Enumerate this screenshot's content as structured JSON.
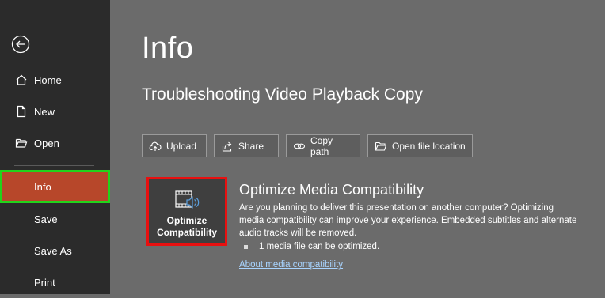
{
  "sidebar": {
    "back_icon": "back-arrow-icon",
    "items": [
      {
        "label": "Home",
        "icon": "home-icon"
      },
      {
        "label": "New",
        "icon": "new-document-icon"
      },
      {
        "label": "Open",
        "icon": "open-folder-icon"
      },
      {
        "label": "Info",
        "active": true
      },
      {
        "label": "Save"
      },
      {
        "label": "Save As"
      },
      {
        "label": "Print"
      }
    ]
  },
  "main": {
    "title": "Info",
    "document_title": "Troubleshooting Video Playback Copy",
    "actions": [
      {
        "label": "Upload",
        "icon": "upload-cloud-icon"
      },
      {
        "label": "Share",
        "icon": "share-icon"
      },
      {
        "label": "Copy path",
        "icon": "link-icon"
      },
      {
        "label": "Open file location",
        "icon": "folder-icon"
      }
    ],
    "optimize": {
      "button_line1": "Optimize",
      "button_line2": "Compatibility",
      "icon": "media-audio-icon",
      "heading": "Optimize Media Compatibility",
      "description": "Are you planning to deliver this presentation on another computer? Optimizing media compatibility can improve your experience. Embedded subtitles and alternate audio tracks will be removed.",
      "bullet": "1 media file can be optimized.",
      "link": "About media compatibility"
    }
  },
  "colors": {
    "sidebar_bg": "#2b2b2b",
    "main_bg": "#6b6b6b",
    "active_item": "#b7472a",
    "active_highlight": "#22d41b",
    "optimize_highlight": "#e81010",
    "link": "#a8d4ff"
  }
}
